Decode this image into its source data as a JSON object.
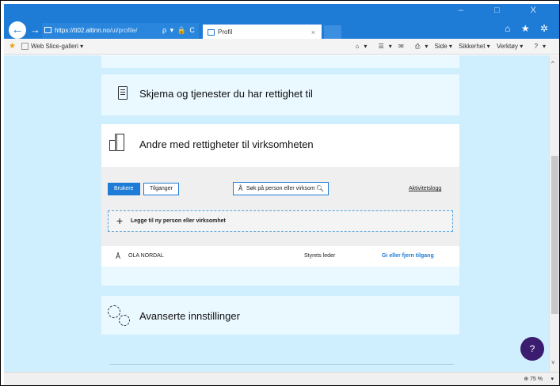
{
  "browser": {
    "url_host": "https://tt02.altinn.no",
    "url_path": "/ui/profile/",
    "addr_tools": "ρ ▾ 🔒 C",
    "tab_title": "Profil",
    "tab_close": "×",
    "window_controls": "– □ X",
    "ie_icons": "⌂ ★ ✲",
    "nav_back": "←",
    "nav_forward": "→"
  },
  "command_bar": {
    "favorites_icon": "star-icon",
    "web_slice": "Web Slice-galleri ▾",
    "items": [
      "▾",
      "▾",
      "▾",
      "Side ▾",
      "Sikkerhet ▾",
      "Verktøy ▾",
      "▾"
    ],
    "home_glyph": "⌂",
    "feed_glyph": "☰",
    "mail_glyph": "✉",
    "print_glyph": "⎙",
    "help_glyph": "?"
  },
  "sections": {
    "skjema_title": "Skjema og tjenester du har rettighet til",
    "andre_title": "Andre med rettigheter til virksomheten",
    "avansert_title": "Avanserte innstillinger"
  },
  "rights_panel": {
    "btn_brukere": "Brukere",
    "btn_tilganger": "Tilganger",
    "search_placeholder": "Søk på person eller virksom",
    "person_glyph": "Å",
    "search_glyph": "🔍︎",
    "aktivitetslogg": "Aktivitetslogg",
    "add_plus": "+",
    "add_label": "Legge til ny person eller virksomhet"
  },
  "users": [
    {
      "name": "OLA NORDAL",
      "role": "Styrets leder",
      "action": "Gi eller fjern tilgang"
    }
  ],
  "help_label": "?",
  "scroll": {
    "up": "^",
    "down": "˅"
  },
  "status_bar": {
    "zoom": "75 %",
    "zoom_glyph": "⊕",
    "arrow": "▾"
  },
  "colors": {
    "accent": "#1e7bd6",
    "page_bg": "#cfefff",
    "help_bg": "#3b1c6e"
  }
}
